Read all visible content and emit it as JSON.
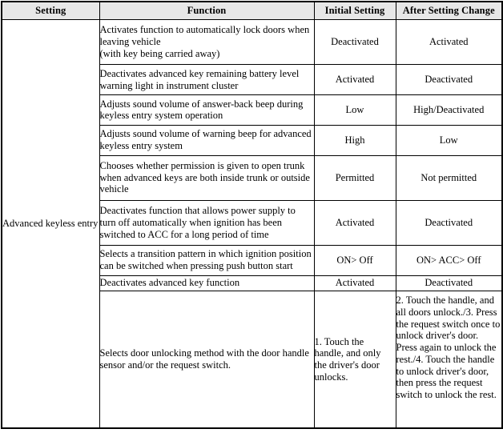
{
  "table": {
    "headers": [
      {
        "label": "Setting",
        "key": "setting"
      },
      {
        "label": "Function",
        "key": "function"
      },
      {
        "label": "Initial Setting",
        "key": "initial"
      },
      {
        "label": "After Setting Change",
        "key": "after"
      }
    ],
    "setting_group": "Advanced keyless entry",
    "rows": [
      {
        "function": "Activates function to automatically lock doors when leaving vehicle\n(with key being carried away)",
        "initial": "Deactivated",
        "after": "Activated"
      },
      {
        "function": "Deactivates advanced key remaining battery level warning light in instrument cluster",
        "initial": "Activated",
        "after": "Deactivated"
      },
      {
        "function": "Adjusts sound volume of answer-back beep during keyless entry system operation",
        "initial": "Low",
        "after": "High/Deactivated"
      },
      {
        "function": "Adjusts sound volume of warning beep for advanced keyless entry system",
        "initial": "High",
        "after": "Low"
      },
      {
        "function": "Chooses whether permission is given to open trunk when advanced keys are both inside trunk or outside vehicle",
        "initial": "Permitted",
        "after": "Not permitted"
      },
      {
        "function": "Deactivates function that allows power supply to turn off automatically when ignition has been switched to ACC for a long period of time",
        "initial": "Activated",
        "after": "Deactivated"
      },
      {
        "function": "Selects a transition pattern in which ignition position can be switched when pressing push button start",
        "initial": "ON> Off",
        "after": "ON> ACC> Off"
      },
      {
        "function": "Deactivates advanced key function",
        "initial": "Activated",
        "after": "Deactivated"
      },
      {
        "function": "Selects door unlocking method with the door handle sensor and/or the request switch.",
        "initial": "1. Touch the handle, and only the driver's door unlocks.",
        "after": "2. Touch the handle, and all doors unlock./3. Press the request switch once to unlock driver's door. Press again to unlock the rest./4. Touch the handle to unlock driver's door, then press the request switch to unlock the rest."
      }
    ]
  },
  "colors": {
    "header_background": "#e7e7e7",
    "border": "#000000",
    "text": "#000000",
    "page_background": "#ffffff"
  }
}
